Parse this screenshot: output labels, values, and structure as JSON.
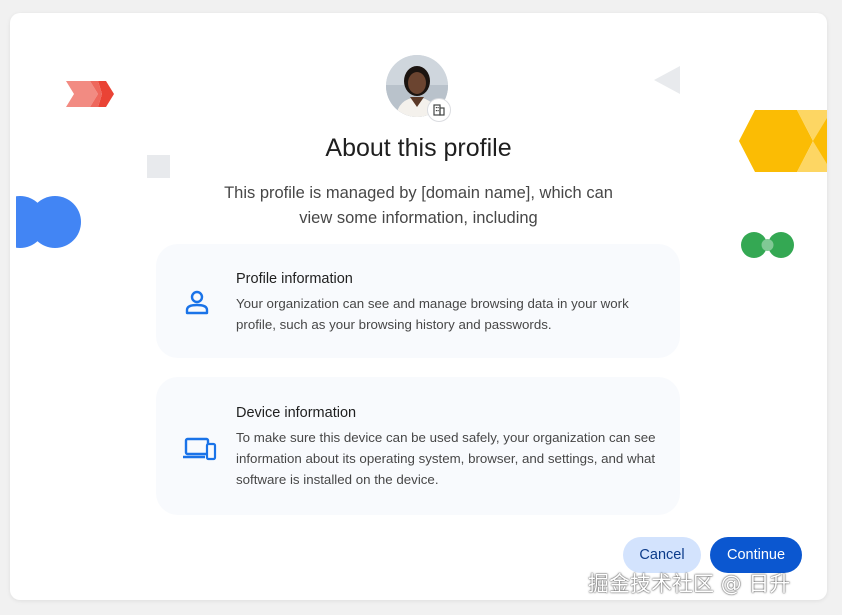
{
  "dialog": {
    "title": "About this profile",
    "subtitle": "This profile is managed by [domain name], which can view some information, including",
    "sections": [
      {
        "icon": "person-icon",
        "title": "Profile information",
        "description": "Your organization can see and manage browsing data in your work profile, such as your browsing history and passwords."
      },
      {
        "icon": "devices-icon",
        "title": "Device information",
        "description": "To make sure this device can be used safely, your organization can see information about its operating system, browser, and settings, and what software is installed on the device."
      }
    ],
    "buttons": {
      "cancel_label": "Cancel",
      "continue_label": "Continue"
    }
  },
  "watermark": "掘金技术社区 @ 日升",
  "colors": {
    "primary": "#0b57d0",
    "tonal_button": "#d3e3fd",
    "card_background": "#f8fafd",
    "icon_blue": "#1a73e8",
    "deco_red": "#ea4335",
    "deco_yellow": "#fbbc04",
    "deco_green": "#34a853",
    "deco_blue": "#4285f4"
  }
}
